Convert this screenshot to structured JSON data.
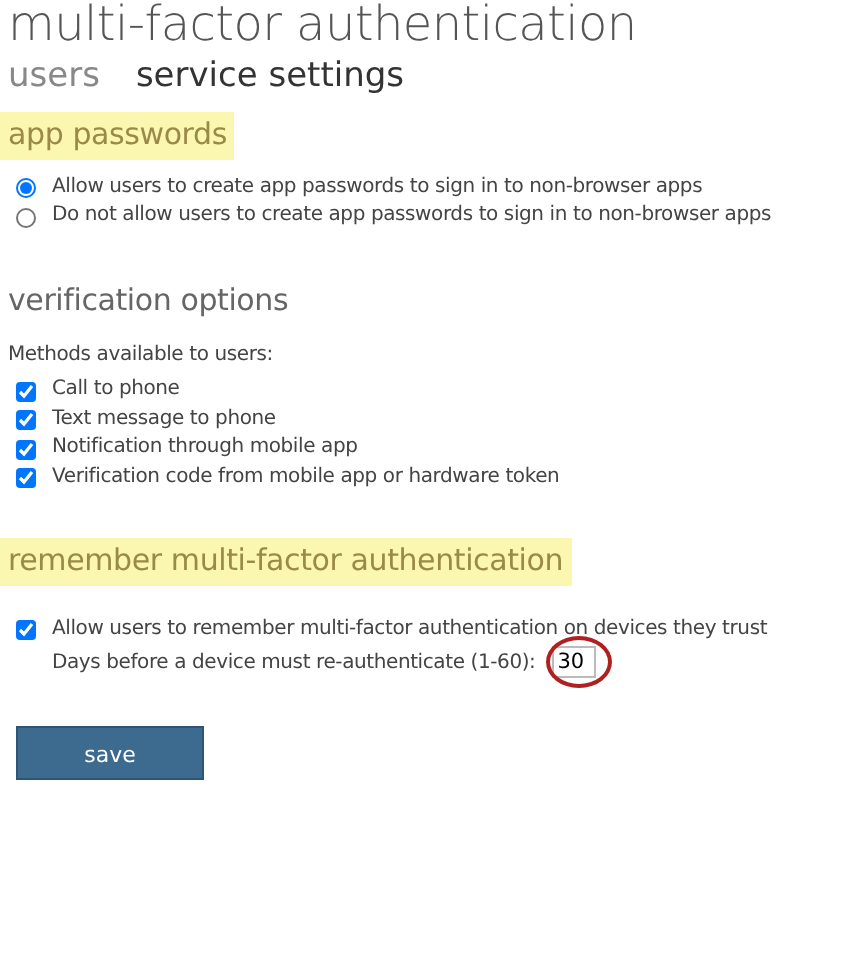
{
  "page": {
    "title": "multi-factor authentication"
  },
  "tabs": [
    {
      "label": "users",
      "selected": false
    },
    {
      "label": "service settings",
      "selected": true
    }
  ],
  "app_passwords": {
    "heading": "app passwords",
    "highlighted": true,
    "options": [
      {
        "label": "Allow users to create app passwords to sign in to non-browser apps",
        "selected": true
      },
      {
        "label": "Do not allow users to create app passwords to sign in to non-browser apps",
        "selected": false
      }
    ]
  },
  "verification_options": {
    "heading": "verification options",
    "highlighted": false,
    "intro": "Methods available to users:",
    "methods": [
      {
        "label": "Call to phone",
        "checked": true
      },
      {
        "label": "Text message to phone",
        "checked": true
      },
      {
        "label": "Notification through mobile app",
        "checked": true
      },
      {
        "label": "Verification code from mobile app or hardware token",
        "checked": true
      }
    ]
  },
  "remember": {
    "heading": "remember multi-factor authentication",
    "highlighted": true,
    "option": {
      "label": "Allow users to remember multi-factor authentication on devices they trust",
      "checked": true
    },
    "days": {
      "label": "Days before a device must re-authenticate (1-60):",
      "value": "30",
      "circled": true
    }
  },
  "save_button": "save"
}
